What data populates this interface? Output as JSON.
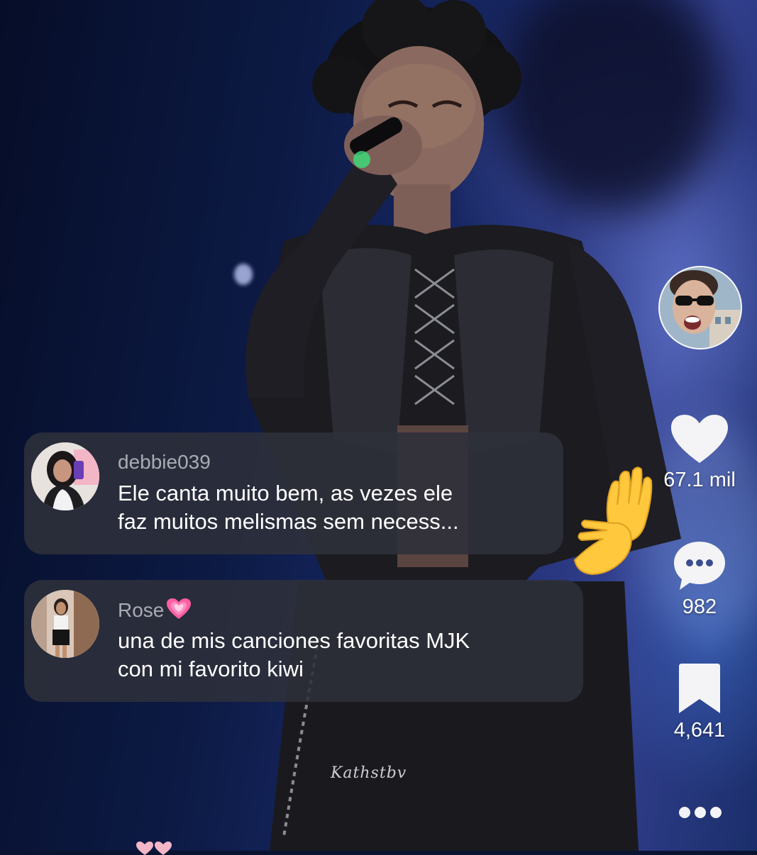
{
  "video": {
    "watermark": "Kathstbv"
  },
  "comments": [
    {
      "username": "debbie039",
      "text": "Ele canta muito bem, as vezes ele\nfaz muitos melismas sem necess..."
    },
    {
      "username": "Rose",
      "username_emoji": "growing-heart-icon",
      "text": "una de mis canciones favoritas MJK\ncon mi favorito kiwi"
    }
  ],
  "actions": {
    "like": {
      "icon": "heart-icon",
      "count": "67.1 mil"
    },
    "comment": {
      "icon": "comment-bubble-icon",
      "count": "982"
    },
    "save": {
      "icon": "bookmark-icon",
      "count": "4,641"
    },
    "more": {
      "icon": "more-dots-icon"
    }
  },
  "colors": {
    "comment_bg": "#2e303a",
    "username": "#a9abb3",
    "text": "#ffffff",
    "emoji_heart": "#ff5fa2"
  }
}
